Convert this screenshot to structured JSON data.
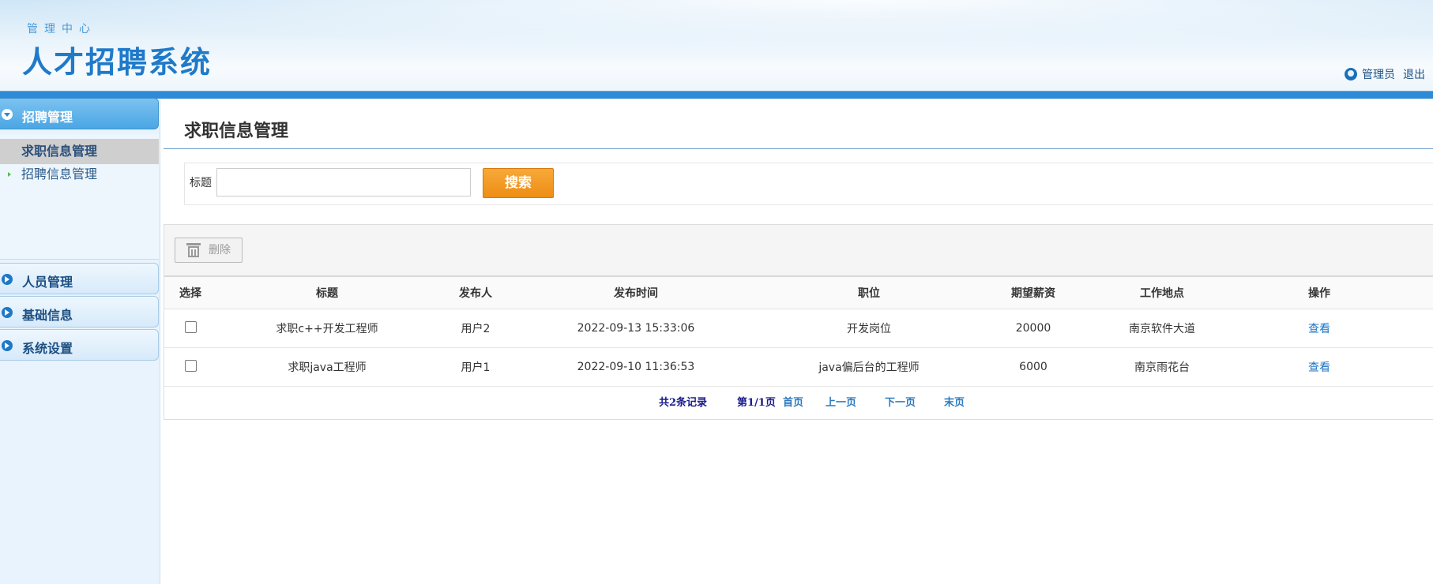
{
  "header": {
    "subtitle": "管理中心",
    "title": "人才招聘系统",
    "user_label": "管理员",
    "logout_label": "退出"
  },
  "sidebar": {
    "groups": [
      {
        "label": "招聘管理",
        "expanded": true
      },
      {
        "label": "人员管理"
      },
      {
        "label": "基础信息"
      },
      {
        "label": "系统设置"
      }
    ],
    "sub_items": [
      {
        "label": "求职信息管理",
        "selected": true
      },
      {
        "label": "招聘信息管理"
      }
    ]
  },
  "main": {
    "page_title": "求职信息管理",
    "search": {
      "label": "标题",
      "value": "",
      "placeholder": "",
      "button": "搜索"
    },
    "toolbar": {
      "delete_label": "删除"
    },
    "table": {
      "headers": [
        "选择",
        "标题",
        "发布人",
        "发布时间",
        "职位",
        "期望薪资",
        "工作地点",
        "操作"
      ],
      "rows": [
        {
          "title": "求职c++开发工程师",
          "publisher": "用户2",
          "time": "2022-09-13 15:33:06",
          "position": "开发岗位",
          "salary": "20000",
          "location": "南京软件大道",
          "op": "查看"
        },
        {
          "title": "求职java工程师",
          "publisher": "用户1",
          "time": "2022-09-10 11:36:53",
          "position": "java偏后台的工程师",
          "salary": "6000",
          "location": "南京雨花台",
          "op": "查看"
        }
      ]
    },
    "pager": {
      "total": "共2条记录",
      "page": "第1/1页",
      "first": "首页",
      "prev": "上一页",
      "next": "下一页",
      "last": "末页"
    }
  },
  "colors": {
    "accent": "#2d8ad6",
    "search_button": "#f19a22",
    "title_text": "#1f7ac9"
  }
}
